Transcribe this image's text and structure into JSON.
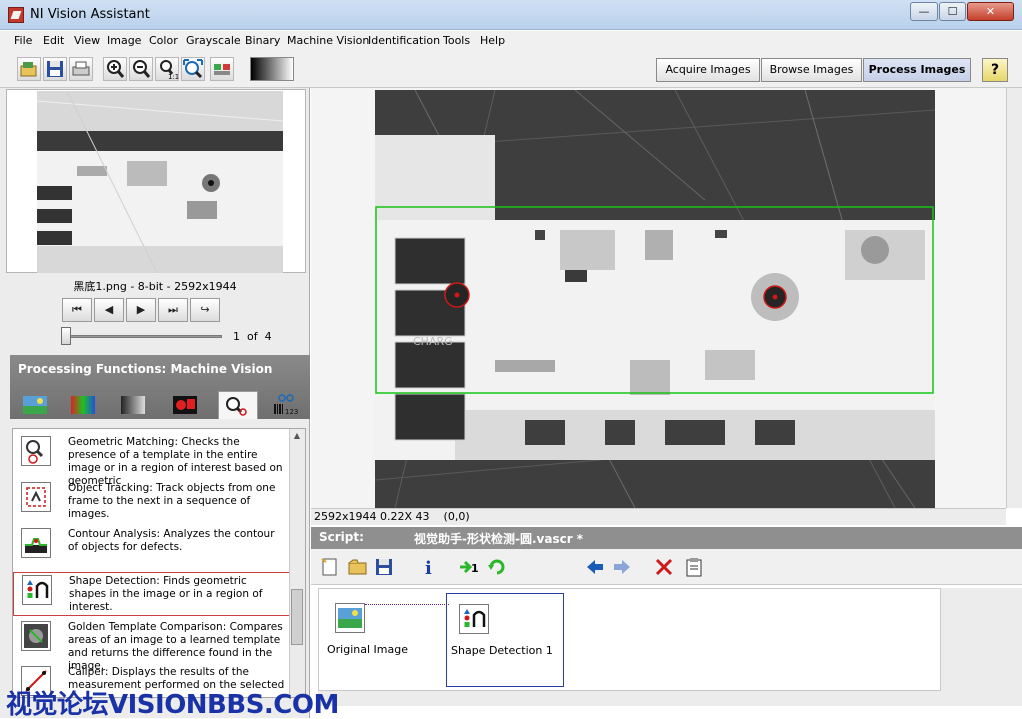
{
  "window": {
    "title": "NI Vision Assistant",
    "min": "—",
    "max": "☐",
    "close": "✕"
  },
  "menu": [
    "File",
    "Edit",
    "View",
    "Image",
    "Color",
    "Grayscale",
    "Binary",
    "Machine Vision",
    "Identification",
    "Tools",
    "Help"
  ],
  "mode_tabs": [
    "Acquire Images",
    "Browse Images",
    "Process Images"
  ],
  "active_mode": "Process Images",
  "help_label": "?",
  "thumbnail": {
    "caption": "黑底1.png - 8-bit - 2592x1944"
  },
  "navigation": {
    "first": "⏮",
    "prev": "◀",
    "next": "▶",
    "last": "⏭",
    "loop": "↪"
  },
  "pager": {
    "current": "1",
    "of": "of",
    "total": "4",
    "text": "1  of  4"
  },
  "processing": {
    "title": "Processing Functions: Machine Vision"
  },
  "functions": [
    {
      "name": "Geometric Matching",
      "text": "Geometric Matching:  Checks the presence of a template in the entire image or in a region of interest based on geometric"
    },
    {
      "name": "Object Tracking",
      "text": "Object Tracking:  Track objects from one frame to the next in a sequence of images."
    },
    {
      "name": "Contour Analysis",
      "text": "Contour Analysis:  Analyzes the contour of objects for defects."
    },
    {
      "name": "Shape Detection",
      "text": "Shape Detection:  Finds geometric shapes in the image or in a region of interest."
    },
    {
      "name": "Golden Template Comparison",
      "text": "Golden Template Comparison:  Compares areas of an image to a learned template and returns the difference found in the image."
    },
    {
      "name": "Caliper",
      "text": "Caliper:  Displays the results of the measurement performed on the selected"
    }
  ],
  "image_status": {
    "size": "2592x1944",
    "zoom": "0.22X",
    "value": "43",
    "coords": "(0,0)"
  },
  "image_text": {
    "charge_label": "CHARG"
  },
  "script": {
    "label": "Script:",
    "name": "视觉助手-形状检测-圆.vascr *",
    "steps": [
      "Original Image",
      "Shape Detection 1"
    ]
  },
  "watermark": "视觉论坛VISIONBBS.COM",
  "colors": {
    "roi": "#16c416",
    "circle": "#d01818",
    "selection": "#c94040",
    "step_selected": "#2a3ea5"
  }
}
